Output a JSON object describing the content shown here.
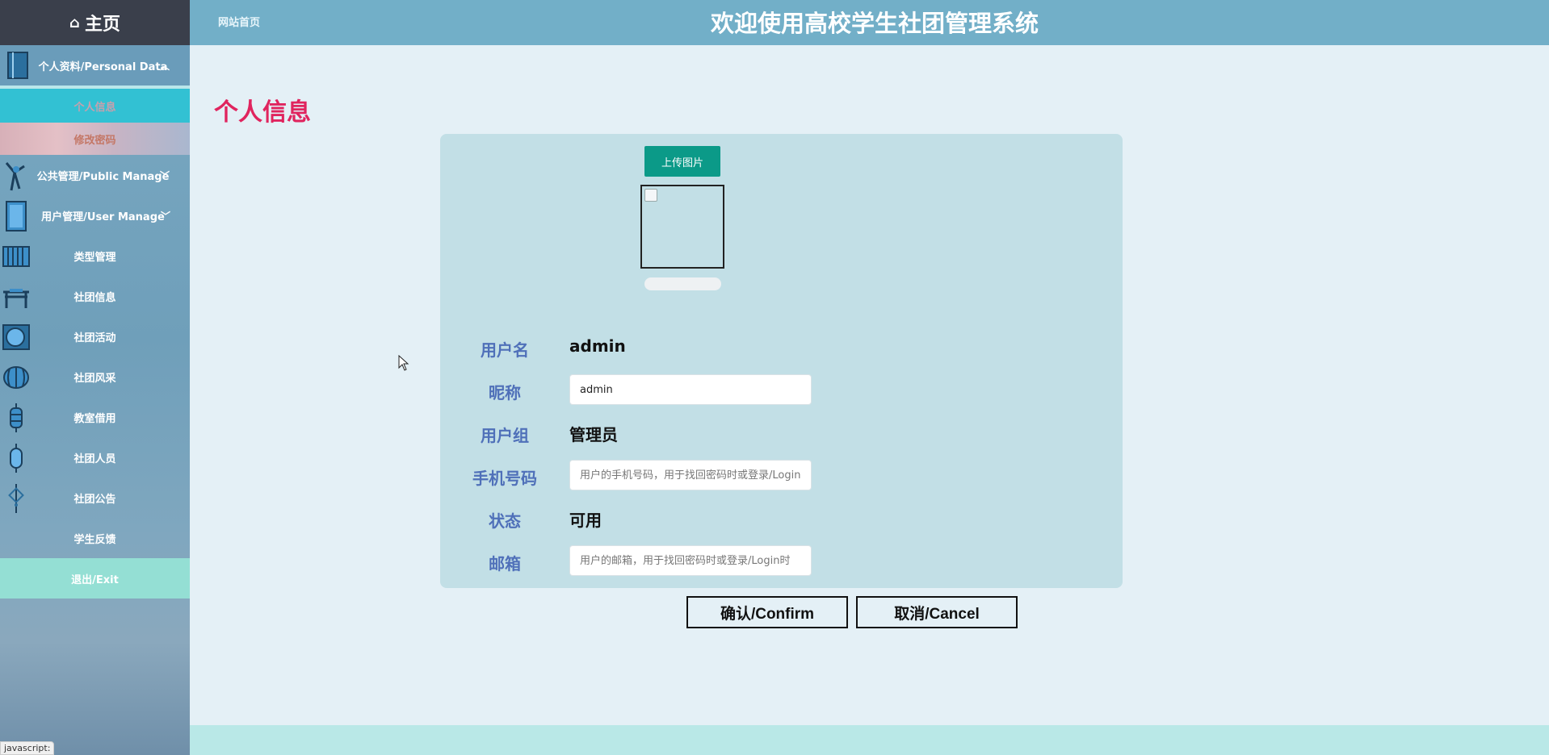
{
  "sidebar": {
    "brand_label": "主页",
    "personal_group": "个人资料/Personal Data",
    "personal_info": "个人信息",
    "change_password": "修改密码",
    "public_manage": "公共管理/Public Manage",
    "user_manage": "用户管理/User Manage",
    "items": [
      "类型管理",
      "社团信息",
      "社团活动",
      "社团风采",
      "教室借用",
      "社团人员",
      "社团公告",
      "学生反馈"
    ],
    "exit_label": "退出/Exit"
  },
  "header": {
    "site_home": "网站首页",
    "title": "欢迎使用高校学生社团管理系统"
  },
  "page": {
    "title": "个人信息",
    "upload_label": "上传图片"
  },
  "form": {
    "username_label": "用户名",
    "username_value": "admin",
    "nickname_label": "昵称",
    "nickname_value": "admin",
    "group_label": "用户组",
    "group_value": "管理员",
    "phone_label": "手机号码",
    "phone_placeholder": "用户的手机号码，用于找回密码时或登录/Login时",
    "status_label": "状态",
    "status_value": "可用",
    "email_label": "邮箱",
    "email_placeholder": "用户的邮箱，用于找回密码时或登录/Login时"
  },
  "actions": {
    "confirm": "确认/Confirm",
    "cancel": "取消/Cancel"
  },
  "status_bar": "javascript:",
  "colors": {
    "accent_title": "#e0245e",
    "header_bg": "#72afc8",
    "upload_btn": "#0b9a88",
    "label_blue": "#4f70b9"
  }
}
